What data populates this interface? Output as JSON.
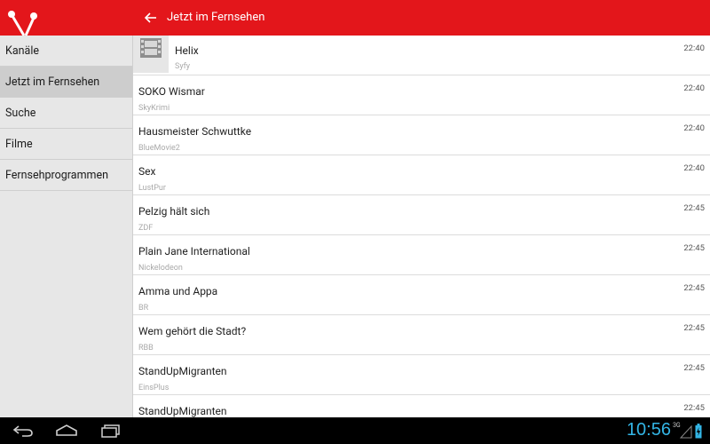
{
  "actionbar": {
    "title": "Jetzt im Fernsehen",
    "color": "#e3161b"
  },
  "drawer": {
    "items": [
      {
        "label": "Kanäle",
        "selected": false
      },
      {
        "label": "Jetzt im Fernsehen",
        "selected": true
      },
      {
        "label": "Suche",
        "selected": false
      },
      {
        "label": "Filme",
        "selected": false
      },
      {
        "label": "Fernsehprogrammen",
        "selected": false
      }
    ]
  },
  "programs": [
    {
      "title": "Helix",
      "channel": "Syfy",
      "time": "22:40",
      "thumbnail": "film-icon"
    },
    {
      "title": "SOKO Wismar",
      "channel": "SkyKrimi",
      "time": "22:40"
    },
    {
      "title": "Hausmeister Schwuttke",
      "channel": "BlueMovie2",
      "time": "22:40"
    },
    {
      "title": "Sex",
      "channel": "LustPur",
      "time": "22:40"
    },
    {
      "title": "Pelzig hält sich",
      "channel": "ZDF",
      "time": "22:45"
    },
    {
      "title": "Plain Jane International",
      "channel": "Nickelodeon",
      "time": "22:45"
    },
    {
      "title": "Amma und Appa",
      "channel": "BR",
      "time": "22:45"
    },
    {
      "title": "Wem gehört die Stadt?",
      "channel": "RBB",
      "time": "22:45"
    },
    {
      "title": "StandUpMigranten",
      "channel": "EinsPlus",
      "time": "22:45"
    },
    {
      "title": "StandUpMigranten",
      "channel": "",
      "time": "22:45"
    }
  ],
  "statusbar": {
    "clock": "10:56",
    "network": "3G",
    "clock_color": "#33b5e5"
  }
}
